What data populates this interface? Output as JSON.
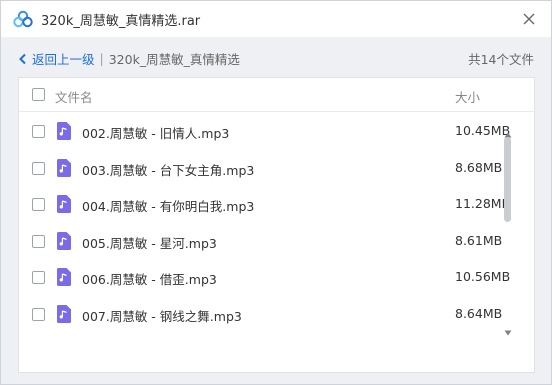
{
  "window": {
    "title": "320k_周慧敏_真情精选.rar",
    "app_icon": "cloud-logo-icon",
    "close_icon": "close-icon"
  },
  "breadcrumb": {
    "back_label": "返回上一级",
    "separator": "|",
    "current": "320k_周慧敏_真情精选"
  },
  "file_count": "共14个文件",
  "list": {
    "columns": {
      "name": "文件名",
      "size": "大小"
    },
    "files": [
      {
        "name": "002.周慧敏 - 旧情人.mp3",
        "size": "10.45MB"
      },
      {
        "name": "003.周慧敏 - 台下女主角.mp3",
        "size": "8.68MB"
      },
      {
        "name": "004.周慧敏 - 有你明白我.mp3",
        "size": "11.28MB"
      },
      {
        "name": "005.周慧敏 - 星河.mp3",
        "size": "8.61MB"
      },
      {
        "name": "006.周慧敏 - 借歪.mp3",
        "size": "10.56MB"
      },
      {
        "name": "007.周慧敏 - 钢线之舞.mp3",
        "size": "8.64MB"
      }
    ]
  },
  "colors": {
    "accent": "#1e6fd9",
    "panel_bg": "#eef0f4",
    "music_icon": "#7b6be6"
  }
}
